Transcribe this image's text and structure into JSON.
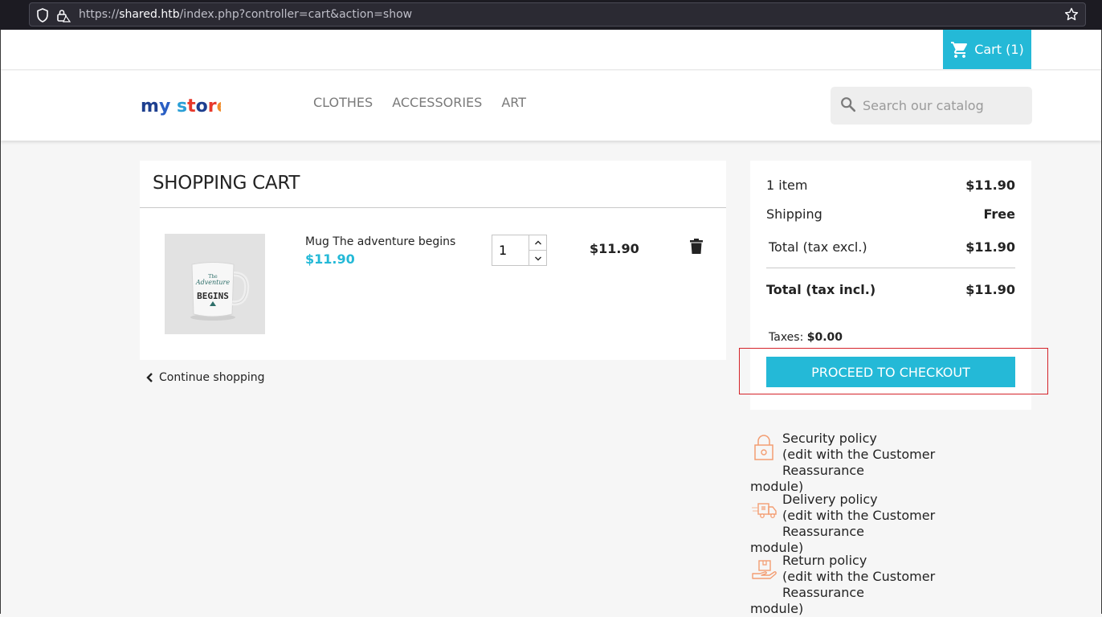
{
  "browser": {
    "url_prefix": "https://",
    "url_host": "shared.htb",
    "url_path": "/index.php?controller=cart&action=show"
  },
  "header": {
    "cart_label": "Cart (1)",
    "logo_text": "my store",
    "menu": [
      "CLOTHES",
      "ACCESSORIES",
      "ART"
    ],
    "search_placeholder": "Search our catalog"
  },
  "cart": {
    "title": "SHOPPING CART",
    "item": {
      "name": "Mug The adventure begins",
      "unit_price": "$11.90",
      "quantity": "1",
      "line_total": "$11.90",
      "image_text": [
        "The",
        "Adventure",
        "BEGINS"
      ]
    },
    "continue_label": "Continue shopping"
  },
  "summary": {
    "items_label": "1 item",
    "items_value": "$11.90",
    "shipping_label": "Shipping",
    "shipping_value": "Free",
    "total_excl_label": "Total (tax excl.)",
    "total_excl_value": "$11.90",
    "total_incl_label": "Total (tax incl.)",
    "total_incl_value": "$11.90",
    "taxes_label": "Taxes:",
    "taxes_value": "$0.00",
    "checkout_label": "PROCEED TO CHECKOUT"
  },
  "reassurance": [
    {
      "title": "Security policy",
      "desc": "(edit with the Customer Reassurance",
      "tail": "module)",
      "icon": "padlock-icon"
    },
    {
      "title": "Delivery policy",
      "desc": "(edit with the Customer Reassurance",
      "tail": "module)",
      "icon": "delivery-truck-icon"
    },
    {
      "title": "Return policy",
      "desc": "(edit with the Customer Reassurance",
      "tail": "module)",
      "icon": "return-box-icon"
    }
  ],
  "colors": {
    "accent": "#24b9d7",
    "highlight": "#d4232a",
    "reassurance_icon": "#f39d72"
  }
}
